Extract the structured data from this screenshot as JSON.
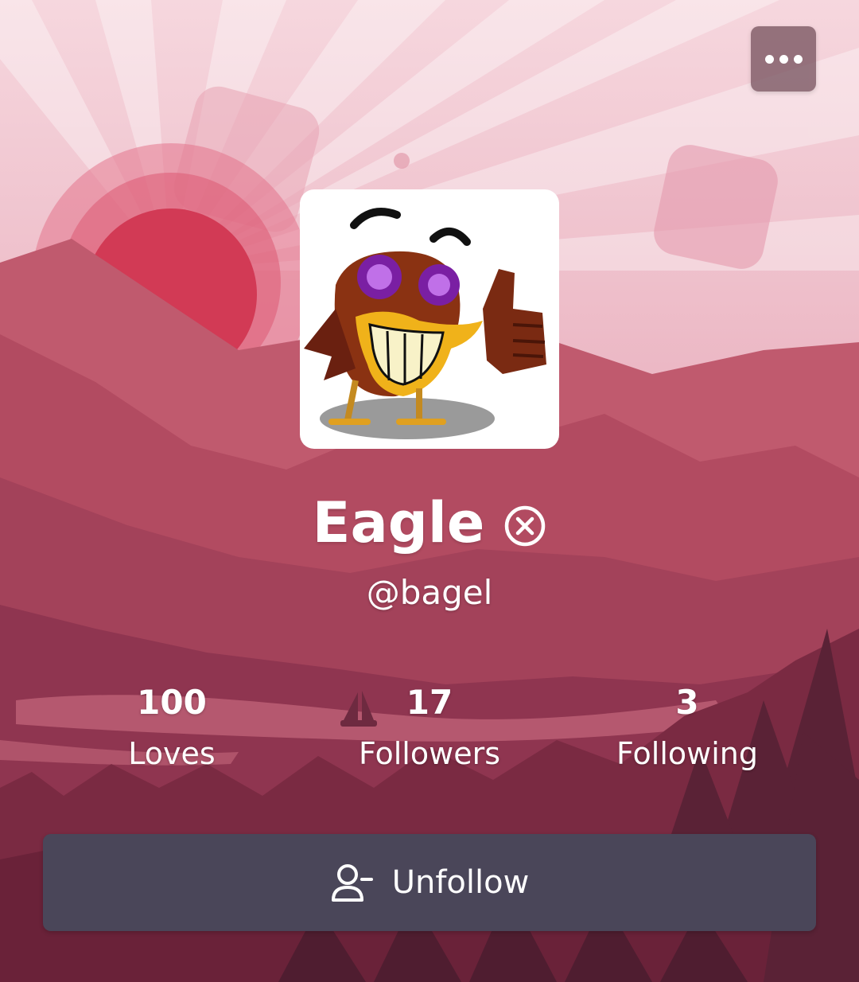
{
  "profile": {
    "name": "Eagle",
    "handle": "@bagel",
    "badge_icon": "circle-x-icon",
    "avatar_description_icon": "cartoon-bird-thumbs-up-icon"
  },
  "stats": [
    {
      "value": "100",
      "label": "Loves"
    },
    {
      "value": "17",
      "label": "Followers"
    },
    {
      "value": "3",
      "label": "Following"
    }
  ],
  "actions": {
    "more_icon": "more-horizontal-icon",
    "unfollow_label": "Unfollow",
    "unfollow_icon": "user-minus-icon"
  },
  "colors": {
    "sky_top": "#f3c8d2",
    "mountain": "#b0455a",
    "sun": "#d23a55",
    "button": "#4a4659"
  }
}
